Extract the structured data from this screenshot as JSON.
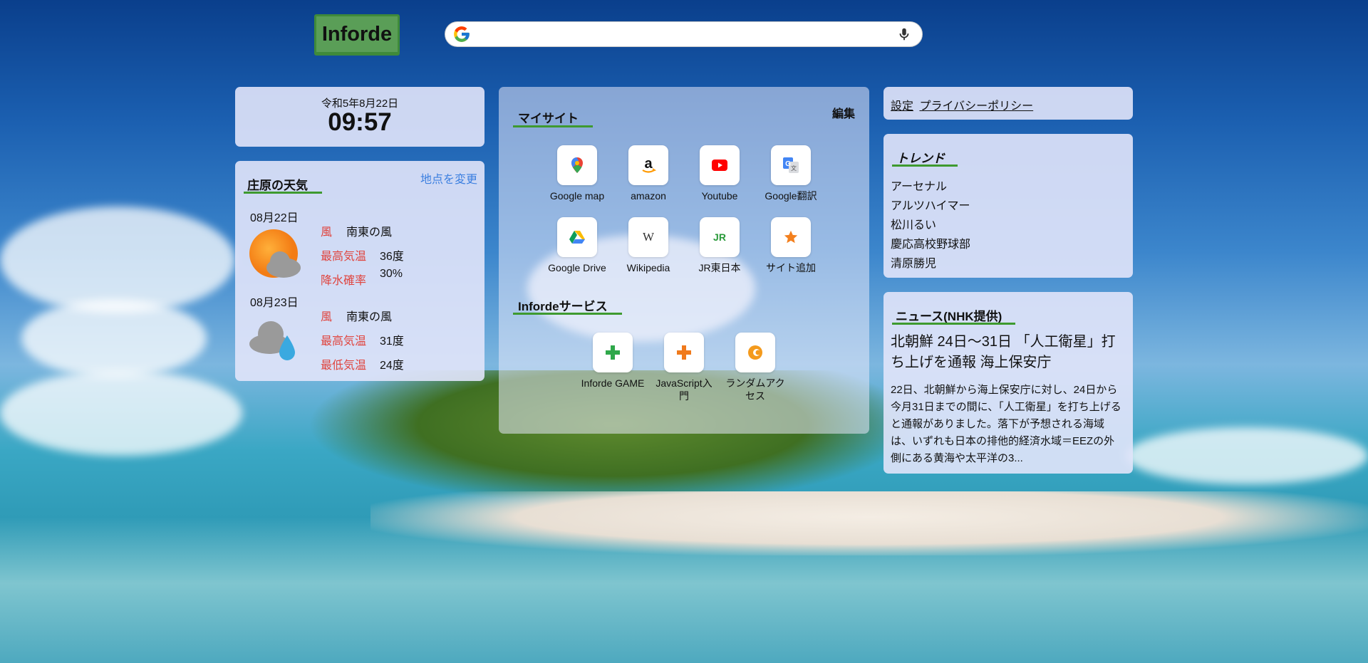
{
  "logo": {
    "text": "Inforde"
  },
  "search": {
    "placeholder": ""
  },
  "clock": {
    "date": "令和5年8月22日",
    "time": "09:57"
  },
  "weather": {
    "title": "庄原の天気",
    "change_location": "地点を変更",
    "days": [
      {
        "date": "08月22日",
        "icon": "sun-cloud-icon",
        "rows": [
          {
            "label": "風",
            "value": "南東の風"
          },
          {
            "label": "最高気温",
            "value": "36度"
          },
          {
            "label": "降水確率",
            "value": "30%"
          }
        ]
      },
      {
        "date": "08月23日",
        "icon": "cloud-rain-icon",
        "rows": [
          {
            "label": "風",
            "value": "南東の風"
          },
          {
            "label": "最高気温",
            "value": "31度"
          },
          {
            "label": "最低気温",
            "value": "24度"
          }
        ]
      }
    ]
  },
  "mysite": {
    "title": "マイサイト",
    "edit_label": "編集",
    "tiles": [
      {
        "label": "Google map",
        "icon": "google-maps-icon"
      },
      {
        "label": "amazon",
        "icon": "amazon-icon"
      },
      {
        "label": "Youtube",
        "icon": "youtube-icon"
      },
      {
        "label": "Google翻訳",
        "icon": "google-translate-icon"
      },
      {
        "label": "Google Drive",
        "icon": "google-drive-icon"
      },
      {
        "label": "Wikipedia",
        "icon": "wikipedia-icon"
      },
      {
        "label": "JR東日本",
        "icon": "jr-east-icon"
      },
      {
        "label": "サイト追加",
        "icon": "star-icon"
      }
    ]
  },
  "services": {
    "title": "Infordeサービス",
    "tiles": [
      {
        "label": "Inforde GAME",
        "icon": "green-cross-icon"
      },
      {
        "label": "JavaScript入門",
        "icon": "orange-cross-icon"
      },
      {
        "label": "ランダムアクセス",
        "icon": "random-access-icon"
      }
    ]
  },
  "links": {
    "settings": "設定",
    "privacy": "プライバシーポリシー"
  },
  "trend": {
    "title": "トレンド",
    "items": [
      "アーセナル",
      "アルツハイマー",
      "松川るい",
      "慶応高校野球部",
      "清原勝児"
    ]
  },
  "news": {
    "title": "ニュース(NHK提供)",
    "headline": "北朝鮮 24日～31日 「人工衛星」打ち上げを通報 海上保安庁",
    "body": "22日、北朝鮮から海上保安庁に対し、24日から今月31日までの間に、「人工衛星」を打ち上げると通報がありました。落下が予想される海域は、いずれも日本の排他的経済水域＝EEZの外側にある黄海や太平洋の3..."
  },
  "colors": {
    "accent_green": "#3e9a2f",
    "label_red": "#e0443e",
    "link_blue": "#3b7fe0"
  }
}
